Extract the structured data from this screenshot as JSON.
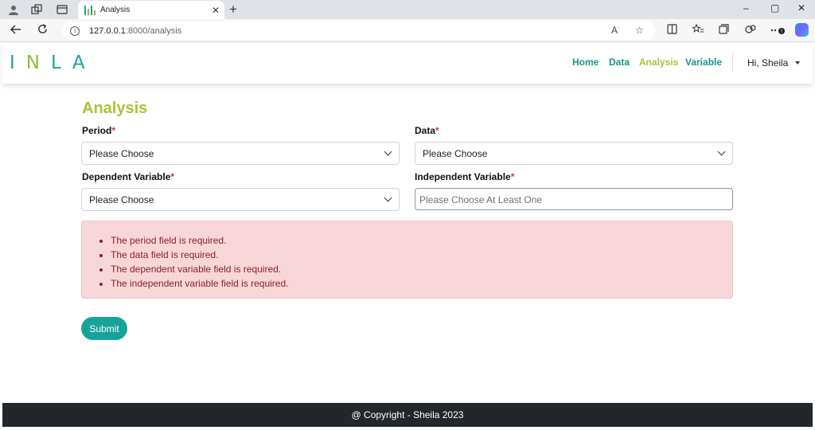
{
  "browser": {
    "tab_title": "Analysis",
    "tab_close": "✕",
    "new_tab": "+",
    "url_host": "127.0.0.1",
    "url_path": ":8000/analysis",
    "window_controls": [
      "–",
      "▢",
      "✕"
    ]
  },
  "navbar": {
    "logo_letters": [
      "I",
      "N",
      "L",
      "A"
    ],
    "menu": [
      {
        "label": "Home",
        "active": false
      },
      {
        "label": "Data",
        "active": false
      },
      {
        "label": "Analysis",
        "active": true
      },
      {
        "label": "Variable",
        "active": false
      }
    ],
    "user_label": "Hi, Sheila"
  },
  "page": {
    "title": "Analysis",
    "fields": {
      "period": {
        "label": "Period",
        "required_mark": "*",
        "value": "Please Choose"
      },
      "data": {
        "label": "Data",
        "required_mark": "*",
        "value": "Please Choose"
      },
      "dependent": {
        "label": "Dependent Variable",
        "required_mark": "*",
        "value": "Please Choose"
      },
      "independent": {
        "label": "Independent Variable",
        "required_mark": "*",
        "placeholder": "Please Choose At Least One"
      }
    },
    "errors": [
      "The period field is required.",
      "The data field is required.",
      "The dependent variable field is required.",
      "The independent variable field is required."
    ],
    "submit_label": "Submit"
  },
  "footer": {
    "text": "@ Copyright - Sheila 2023"
  },
  "colors": {
    "brand_teal": "#16a39a",
    "brand_green": "#a7c43a",
    "alert_bg": "#f8d7da",
    "alert_text": "#8a1f2b",
    "required": "#d0313c",
    "footer_bg": "#23272b"
  },
  "icons": [
    "profile-icon",
    "workspaces-icon",
    "tab-actions-icon",
    "back-arrow-icon",
    "refresh-icon",
    "site-info-icon",
    "read-aloud-icon",
    "favorite-star-icon",
    "split-screen-icon",
    "favorites-icon",
    "collections-icon",
    "extensions-icon",
    "more-options-icon",
    "copilot-icon",
    "chevron-down-icon",
    "caret-down-icon"
  ]
}
